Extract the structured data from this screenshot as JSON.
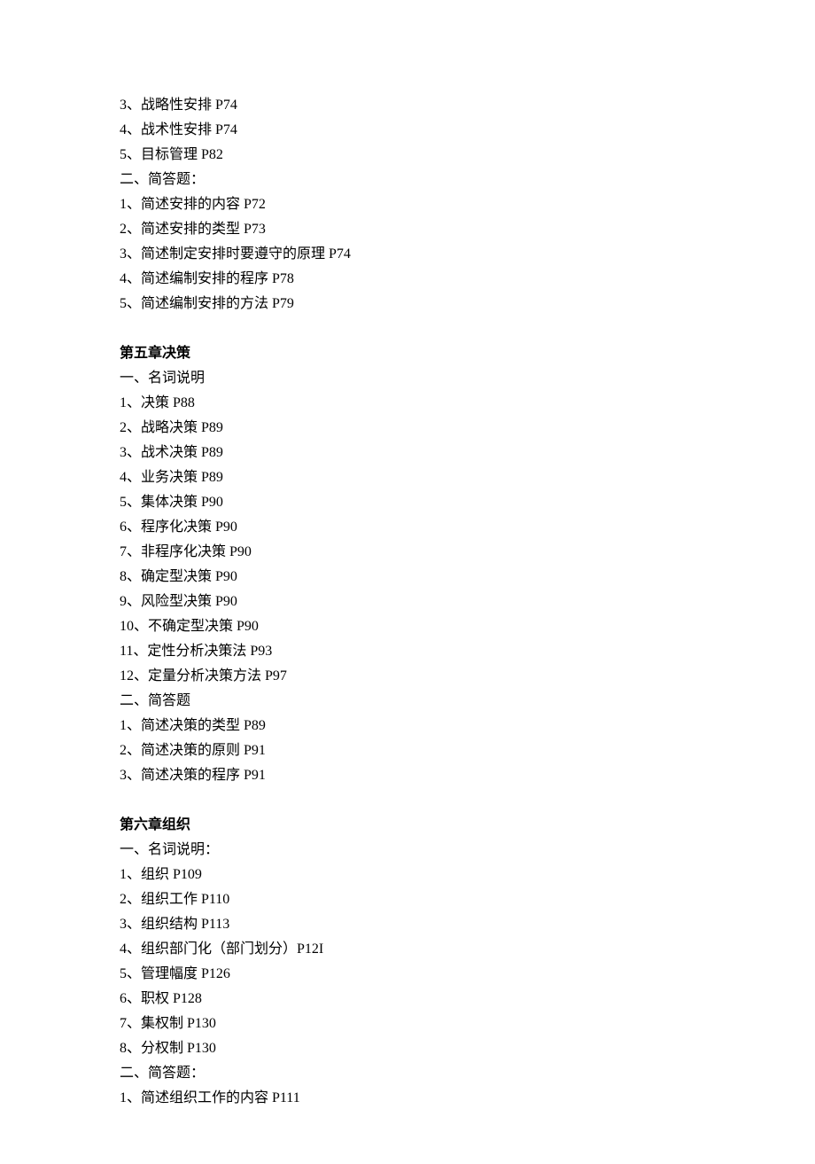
{
  "lines": [
    {
      "text": "3、战略性安排 P74",
      "kind": "line"
    },
    {
      "text": "4、战术性安排 P74",
      "kind": "line"
    },
    {
      "text": "5、目标管理 P82",
      "kind": "line"
    },
    {
      "text": "二、简答题：",
      "kind": "line"
    },
    {
      "text": "1、简述安排的内容 P72",
      "kind": "line"
    },
    {
      "text": "2、简述安排的类型 P73",
      "kind": "line"
    },
    {
      "text": "3、简述制定安排时要遵守的原理 P74",
      "kind": "line"
    },
    {
      "text": "4、简述编制安排的程序 P78",
      "kind": "line"
    },
    {
      "text": "5、简述编制安排的方法 P79",
      "kind": "line"
    },
    {
      "text": "",
      "kind": "spacer"
    },
    {
      "text": "第五章决策",
      "kind": "heading"
    },
    {
      "text": "一、名词说明",
      "kind": "line"
    },
    {
      "text": "1、决策 P88",
      "kind": "line"
    },
    {
      "text": "2、战略决策 P89",
      "kind": "line"
    },
    {
      "text": "3、战术决策 P89",
      "kind": "line"
    },
    {
      "text": "4、业务决策 P89",
      "kind": "line"
    },
    {
      "text": "5、集体决策 P90",
      "kind": "line"
    },
    {
      "text": "6、程序化决策 P90",
      "kind": "line"
    },
    {
      "text": "7、非程序化决策 P90",
      "kind": "line"
    },
    {
      "text": "8、确定型决策 P90",
      "kind": "line"
    },
    {
      "text": "9、风险型决策 P90",
      "kind": "line"
    },
    {
      "text": "10、不确定型决策 P90",
      "kind": "line"
    },
    {
      "text": "11、定性分析决策法 P93",
      "kind": "line"
    },
    {
      "text": "12、定量分析决策方法 P97",
      "kind": "line"
    },
    {
      "text": "二、简答题",
      "kind": "line"
    },
    {
      "text": "1、简述决策的类型 P89",
      "kind": "line"
    },
    {
      "text": "2、简述决策的原则 P91",
      "kind": "line"
    },
    {
      "text": "3、简述决策的程序 P91",
      "kind": "line"
    },
    {
      "text": "",
      "kind": "spacer"
    },
    {
      "text": "第六章组织",
      "kind": "heading"
    },
    {
      "text": "一、名词说明：",
      "kind": "line"
    },
    {
      "text": "1、组织 P109",
      "kind": "line"
    },
    {
      "text": "2、组织工作 P110",
      "kind": "line"
    },
    {
      "text": "3、组织结构 P113",
      "kind": "line"
    },
    {
      "text": "4、组织部门化（部门划分）P12I",
      "kind": "line"
    },
    {
      "text": "5、管理幅度 P126",
      "kind": "line"
    },
    {
      "text": "6、职权 P128",
      "kind": "line"
    },
    {
      "text": "7、集权制 P130",
      "kind": "line"
    },
    {
      "text": "8、分权制 P130",
      "kind": "line"
    },
    {
      "text": "二、简答题：",
      "kind": "line"
    },
    {
      "text": "1、简述组织工作的内容 P111",
      "kind": "line"
    }
  ]
}
